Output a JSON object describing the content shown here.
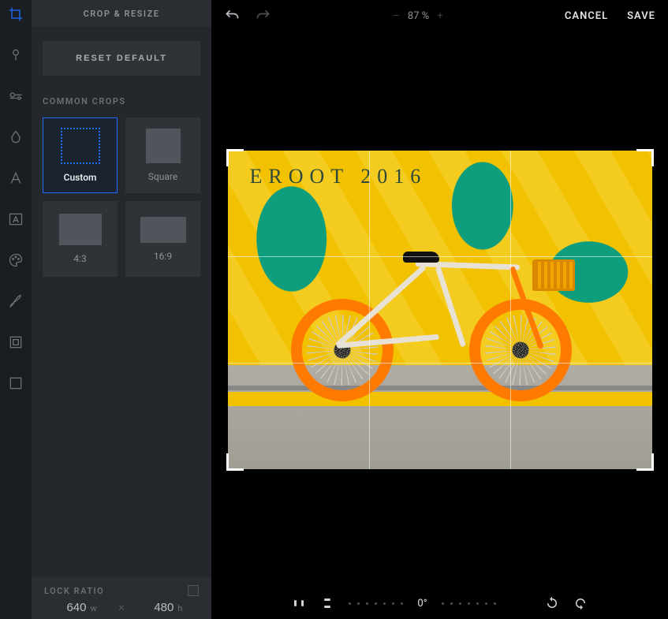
{
  "panel": {
    "title": "CROP & RESIZE",
    "reset_label": "RESET DEFAULT",
    "section_label": "COMMON CROPS",
    "crops": [
      {
        "label": "Custom"
      },
      {
        "label": "Square"
      },
      {
        "label": "4:3"
      },
      {
        "label": "16:9"
      }
    ],
    "lock_label": "LOCK RATIO",
    "width_value": "640",
    "width_unit": "w",
    "height_value": "480",
    "height_unit": "h"
  },
  "topbar": {
    "zoom_display": "87 %",
    "cancel": "CANCEL",
    "save": "SAVE"
  },
  "canvas": {
    "wall_text": "EROOT  2016"
  },
  "bottombar": {
    "angle": "0°"
  },
  "tools": [
    "crop",
    "adjust",
    "tune",
    "liquify",
    "text",
    "mask",
    "paint",
    "brush",
    "frame",
    "canvas"
  ]
}
